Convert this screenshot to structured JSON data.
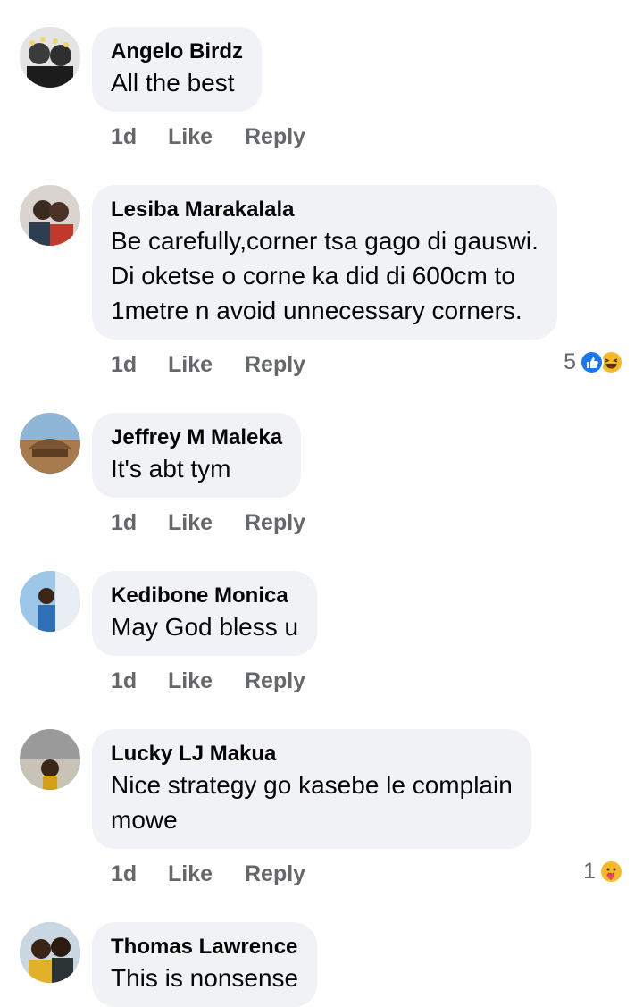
{
  "comments": [
    {
      "author": "Angelo Birdz",
      "text": "All the best",
      "time": "1d",
      "like": "Like",
      "reply": "Reply",
      "reaction_count": "",
      "reactions": []
    },
    {
      "author": "Lesiba Marakalala",
      "text": "Be carefully,corner tsa gago di gauswi.\nDi oketse o corne ka did di 600cm to\n1metre n avoid unnecessary corners.",
      "time": "1d",
      "like": "Like",
      "reply": "Reply",
      "reaction_count": "5",
      "reactions": [
        "like-icon",
        "haha-icon"
      ]
    },
    {
      "author": "Jeffrey M Maleka",
      "text": "It's abt tym",
      "time": "1d",
      "like": "Like",
      "reply": "Reply",
      "reaction_count": "",
      "reactions": []
    },
    {
      "author": "Kedibone Monica",
      "text": "May God bless u",
      "time": "1d",
      "like": "Like",
      "reply": "Reply",
      "reaction_count": "",
      "reactions": []
    },
    {
      "author": "Lucky LJ Makua",
      "text": "Nice strategy go kasebe le complain\nmowe",
      "time": "1d",
      "like": "Like",
      "reply": "Reply",
      "reaction_count": "1",
      "reactions": [
        "care-icon"
      ]
    },
    {
      "author": "Thomas Lawrence",
      "text": "This is nonsense",
      "time": "",
      "like": "",
      "reply": "",
      "reaction_count": "",
      "reactions": []
    }
  ],
  "colors": {
    "bubble": "#f0f2f5",
    "meta_text": "#65676b",
    "like_blue": "#1877f2",
    "emoji_yellow": "#f7b928"
  }
}
